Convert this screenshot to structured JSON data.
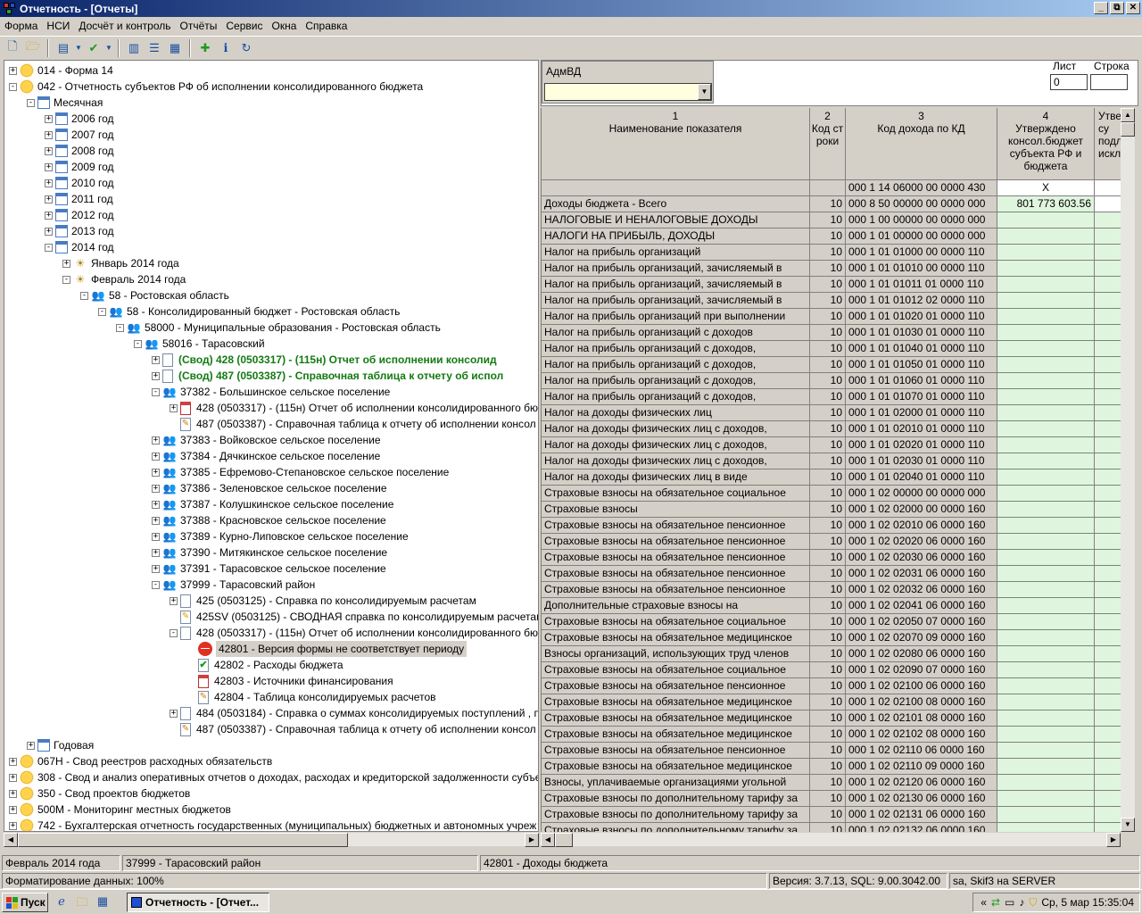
{
  "window": {
    "title": "Отчетность - [Отчеты]",
    "controls": [
      "_",
      "⧉",
      "✕"
    ]
  },
  "menu": [
    "Форма",
    "НСИ",
    "Досчёт и контроль",
    "Отчёты",
    "Сервис",
    "Окна",
    "Справка"
  ],
  "tree": {
    "rows": [
      {
        "text": "014 - Форма 14",
        "level": 0,
        "exp": "+",
        "icon": "folder"
      },
      {
        "text": "042 - Отчетность субъектов РФ об исполнении консолидированного бюджета",
        "level": 0,
        "exp": "-",
        "icon": "folder"
      },
      {
        "text": "Месячная",
        "level": 1,
        "exp": "-",
        "icon": "month"
      },
      {
        "text": "2006 год",
        "level": 2,
        "exp": "+",
        "icon": "month"
      },
      {
        "text": "2007 год",
        "level": 2,
        "exp": "+",
        "icon": "month"
      },
      {
        "text": "2008 год",
        "level": 2,
        "exp": "+",
        "icon": "month"
      },
      {
        "text": "2009 год",
        "level": 2,
        "exp": "+",
        "icon": "month"
      },
      {
        "text": "2010 год",
        "level": 2,
        "exp": "+",
        "icon": "month"
      },
      {
        "text": "2011 год",
        "level": 2,
        "exp": "+",
        "icon": "month"
      },
      {
        "text": "2012 год",
        "level": 2,
        "exp": "+",
        "icon": "month"
      },
      {
        "text": "2013 год",
        "level": 2,
        "exp": "+",
        "icon": "month"
      },
      {
        "text": "2014 год",
        "level": 2,
        "exp": "-",
        "icon": "month"
      },
      {
        "text": "Январь 2014 года",
        "level": 3,
        "exp": "+",
        "icon": "bee"
      },
      {
        "text": "Февраль 2014 года",
        "level": 3,
        "exp": "-",
        "icon": "bee"
      },
      {
        "text": "58 - Ростовская область",
        "level": 4,
        "exp": "-",
        "icon": "people"
      },
      {
        "text": "58 - Консолидированный бюджет - Ростовская область",
        "level": 5,
        "exp": "-",
        "icon": "people"
      },
      {
        "text": "58000 - Муниципальные образования - Ростовская область",
        "level": 6,
        "exp": "-",
        "icon": "people"
      },
      {
        "text": "58016 - Тарасовский",
        "level": 7,
        "exp": "-",
        "icon": "people"
      },
      {
        "text": "(Свод) 428 (0503317) - (115н) Отчет  об исполнении консолид",
        "level": 8,
        "exp": "+",
        "icon": "doc",
        "style": "green"
      },
      {
        "text": "(Свод) 487 (0503387) - Справочная таблица к отчету об испол",
        "level": 8,
        "exp": "+",
        "icon": "doc",
        "style": "green"
      },
      {
        "text": "37382 - Большинское сельское поселение",
        "level": 8,
        "exp": "-",
        "icon": "people"
      },
      {
        "text": "428 (0503317) - (115н) Отчет  об исполнении консолидированного бю",
        "level": 9,
        "exp": "+",
        "icon": "docred"
      },
      {
        "text": "487 (0503387) - Справочная таблица к отчету об исполнении консол",
        "level": 9,
        "exp": "",
        "icon": "docedit"
      },
      {
        "text": "37383 - Войковское сельское поселение",
        "level": 8,
        "exp": "+",
        "icon": "people"
      },
      {
        "text": "37384 - Дячкинское сельское поселение",
        "level": 8,
        "exp": "+",
        "icon": "people"
      },
      {
        "text": "37385 - Ефремово-Степановское сельское поселение",
        "level": 8,
        "exp": "+",
        "icon": "people"
      },
      {
        "text": "37386 - Зеленовское сельское поселение",
        "level": 8,
        "exp": "+",
        "icon": "people"
      },
      {
        "text": "37387 - Колушкинское сельское поселение",
        "level": 8,
        "exp": "+",
        "icon": "people"
      },
      {
        "text": "37388 - Красновское сельское поселение",
        "level": 8,
        "exp": "+",
        "icon": "people"
      },
      {
        "text": "37389 - Курно-Липовское сельское поселение",
        "level": 8,
        "exp": "+",
        "icon": "people"
      },
      {
        "text": "37390 - Митякинское сельское поселение",
        "level": 8,
        "exp": "+",
        "icon": "people"
      },
      {
        "text": "37391 - Тарасовское сельское поселение",
        "level": 8,
        "exp": "+",
        "icon": "people"
      },
      {
        "text": "37999 - Тарасовский район",
        "level": 8,
        "exp": "-",
        "icon": "people"
      },
      {
        "text": "425 (0503125) - Справка по консолидируемым расчетам",
        "level": 9,
        "exp": "+",
        "icon": "doc"
      },
      {
        "text": "425SV (0503125) - СВОДНАЯ справка по консолидируемым расчетам",
        "level": 9,
        "exp": "",
        "icon": "docsv"
      },
      {
        "text": "428 (0503317) - (115н) Отчет  об исполнении консолидированного бю",
        "level": 9,
        "exp": "-",
        "icon": "doc"
      },
      {
        "text": "42801 - Версия формы не соответствует периоду",
        "level": 10,
        "exp": "",
        "icon": "err",
        "style": "sel"
      },
      {
        "text": "42802 - Расходы бюджета",
        "level": 10,
        "exp": "",
        "icon": "docok"
      },
      {
        "text": "42803 - Источники финансирования",
        "level": 10,
        "exp": "",
        "icon": "docred"
      },
      {
        "text": "42804 - Таблица консолидируемых расчетов",
        "level": 10,
        "exp": "",
        "icon": "docedit"
      },
      {
        "text": "484 (0503184) - Справка о суммах консолидируемых поступлений , п",
        "level": 9,
        "exp": "+",
        "icon": "doc"
      },
      {
        "text": "487 (0503387) - Справочная таблица к отчету об исполнении консол",
        "level": 9,
        "exp": "",
        "icon": "docedit"
      },
      {
        "text": "Годовая",
        "level": 1,
        "exp": "+",
        "icon": "month"
      },
      {
        "text": "067Н - Свод реестров расходных обязательств",
        "level": 0,
        "exp": "+",
        "icon": "folder"
      },
      {
        "text": "308 - Свод и анализ оперативных отчетов о доходах, расходах и кредиторской задолженности субъек",
        "level": 0,
        "exp": "+",
        "icon": "folder"
      },
      {
        "text": "350 - Свод проектов бюджетов",
        "level": 0,
        "exp": "+",
        "icon": "folder"
      },
      {
        "text": "500М - Мониторинг местных бюджетов",
        "level": 0,
        "exp": "+",
        "icon": "folder"
      },
      {
        "text": "742 - Бухгалтерская отчетность государственных (муниципальных) бюджетных и автономных учреж",
        "level": 0,
        "exp": "+",
        "icon": "folder"
      }
    ]
  },
  "filter": {
    "adm_label": "АдмВД",
    "adm_value": "",
    "list_label": "Лист",
    "list_value": "0",
    "row_label": "Строка",
    "row_value": ""
  },
  "grid": {
    "headers": [
      {
        "num": "1",
        "title": "Наименование показателя"
      },
      {
        "num": "2",
        "title": "Код строки"
      },
      {
        "num": "3",
        "title": "Код дохода по КД"
      },
      {
        "num": "4",
        "title": "Утверждено консол.бюджет субъекта РФ и бюджета"
      },
      {
        "num": "",
        "title": "Утве су подл искл"
      }
    ],
    "rows": [
      [
        "",
        "",
        "000  1  14  06000  00  0000  430",
        "X"
      ],
      [
        "Доходы бюджета - Всего",
        "10",
        "000  8  50  00000  00  0000  000",
        "801 773 603.56"
      ],
      [
        "НАЛОГОВЫЕ И НЕНАЛОГОВЫЕ ДОХОДЫ",
        "10",
        "000  1  00  00000  00  0000  000",
        ""
      ],
      [
        "НАЛОГИ НА ПРИБЫЛЬ, ДОХОДЫ",
        "10",
        "000  1  01  00000  00  0000  000",
        ""
      ],
      [
        "Налог на прибыль организаций",
        "10",
        "000  1  01  01000  00  0000  110",
        ""
      ],
      [
        "Налог на прибыль организаций, зачисляемый в",
        "10",
        "000  1  01  01010  00  0000  110",
        ""
      ],
      [
        "Налог на прибыль организаций, зачисляемый в",
        "10",
        "000  1  01  01011  01  0000  110",
        ""
      ],
      [
        "Налог на прибыль организаций, зачисляемый в",
        "10",
        "000  1  01  01012  02  0000  110",
        ""
      ],
      [
        "Налог на прибыль организаций при выполнении",
        "10",
        "000  1  01  01020  01  0000  110",
        ""
      ],
      [
        "Налог на прибыль организаций с доходов",
        "10",
        "000  1  01  01030  01  0000  110",
        ""
      ],
      [
        "Налог на прибыль организаций с доходов,",
        "10",
        "000  1  01  01040  01  0000  110",
        ""
      ],
      [
        "Налог на прибыль организаций с доходов,",
        "10",
        "000  1  01  01050  01  0000  110",
        ""
      ],
      [
        "Налог на прибыль организаций с доходов,",
        "10",
        "000  1  01  01060  01  0000  110",
        ""
      ],
      [
        "Налог на прибыль организаций с доходов,",
        "10",
        "000  1  01  01070  01  0000  110",
        ""
      ],
      [
        "Налог на доходы физических лиц",
        "10",
        "000  1  01  02000  01  0000  110",
        ""
      ],
      [
        "Налог на доходы физических лиц с доходов,",
        "10",
        "000  1  01  02010  01  0000  110",
        ""
      ],
      [
        "Налог на доходы физических лиц с доходов,",
        "10",
        "000  1  01  02020  01  0000  110",
        ""
      ],
      [
        "Налог на доходы физических лиц с доходов,",
        "10",
        "000  1  01  02030  01  0000  110",
        ""
      ],
      [
        "Налог на доходы физических лиц в виде",
        "10",
        "000  1  01  02040  01  0000  110",
        ""
      ],
      [
        "Страховые взносы на обязательное социальное",
        "10",
        "000  1  02  00000  00  0000  000",
        ""
      ],
      [
        "Страховые взносы",
        "10",
        "000  1  02  02000  00  0000  160",
        ""
      ],
      [
        "Страховые взносы на обязательное пенсионное",
        "10",
        "000  1  02  02010  06  0000  160",
        ""
      ],
      [
        "Страховые взносы на обязательное пенсионное",
        "10",
        "000  1  02  02020  06  0000  160",
        ""
      ],
      [
        "Страховые взносы на обязательное пенсионное",
        "10",
        "000  1  02  02030  06  0000  160",
        ""
      ],
      [
        "Страховые взносы на обязательное пенсионное",
        "10",
        "000  1  02  02031  06  0000  160",
        ""
      ],
      [
        "Страховые взносы на обязательное пенсионное",
        "10",
        "000  1  02  02032  06  0000  160",
        ""
      ],
      [
        "Дополнительные страховые взносы на",
        "10",
        "000  1  02  02041  06  0000  160",
        ""
      ],
      [
        "Страховые взносы на обязательное социальное",
        "10",
        "000  1  02  02050  07  0000  160",
        ""
      ],
      [
        "Страховые взносы на обязательное медицинское",
        "10",
        "000  1  02  02070  09  0000  160",
        ""
      ],
      [
        "Взносы организаций, использующих труд членов",
        "10",
        "000  1  02  02080  06  0000  160",
        ""
      ],
      [
        "Страховые взносы на обязательное социальное",
        "10",
        "000  1  02  02090  07  0000  160",
        ""
      ],
      [
        "Страховые взносы на обязательное пенсионное",
        "10",
        "000  1  02  02100  06  0000  160",
        ""
      ],
      [
        "Страховые взносы на обязательное медицинское",
        "10",
        "000  1  02  02100  08  0000  160",
        ""
      ],
      [
        "Страховые взносы на обязательное медицинское",
        "10",
        "000  1  02  02101  08  0000  160",
        ""
      ],
      [
        "Страховые взносы на обязательное медицинское",
        "10",
        "000  1  02  02102  08  0000  160",
        ""
      ],
      [
        "Страховые взносы на обязательное пенсионное",
        "10",
        "000  1  02  02110  06  0000  160",
        ""
      ],
      [
        "Страховые взносы на обязательное медицинское",
        "10",
        "000  1  02  02110  09  0000  160",
        ""
      ],
      [
        "Взносы, уплачиваемые организациями угольной",
        "10",
        "000  1  02  02120  06  0000  160",
        ""
      ],
      [
        "Страховые взносы по дополнительному тарифу за",
        "10",
        "000  1  02  02130  06  0000  160",
        ""
      ],
      [
        "Страховые взносы по дополнительному тарифу за",
        "10",
        "000  1  02  02131  06  0000  160",
        ""
      ],
      [
        "Страховые взносы по дополнительному тарифу за",
        "10",
        "000  1  02  02132  06  0000  160",
        ""
      ]
    ]
  },
  "status": {
    "period": "Февраль 2014 года",
    "org": "37999 - Тарасовский район",
    "form": "42801 - Доходы бюджета",
    "format": "Форматирование данных: 100%",
    "version": "Версия: 3.7.13, SQL: 9.00.3042.00",
    "user": "sa, Skif3 на SERVER"
  },
  "taskbar": {
    "start": "Пуск",
    "task": "Отчетность - [Отчет...",
    "clock": "Ср, 5 мар 15:35:04",
    "tray_arrow": "«"
  },
  "colors": {
    "title_start": "#0a246a",
    "title_end": "#a6caf0",
    "green_text": "#137a13",
    "cell_green": "#e0f5dd"
  }
}
